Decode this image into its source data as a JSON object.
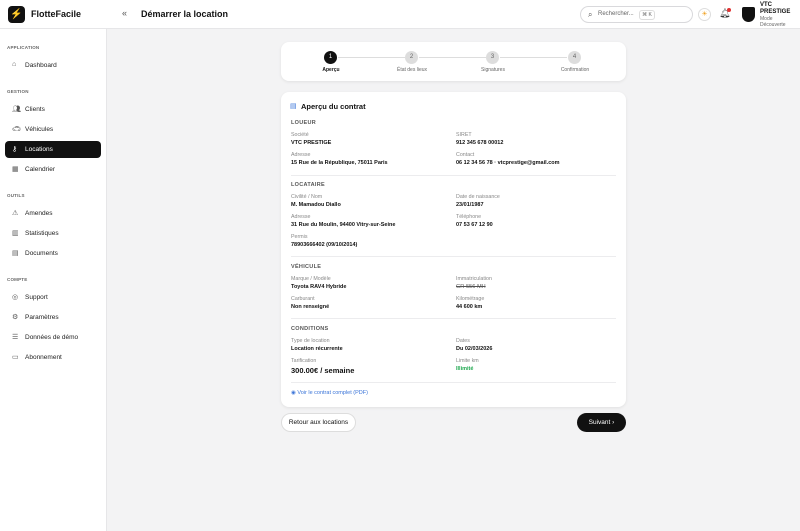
{
  "app": {
    "brand": "FlotteFacile",
    "page_title": "Démarrer la location"
  },
  "header": {
    "search_placeholder": "Rechercher...",
    "search_shortcut": "⌘ K",
    "user_name": "VTC PRESTIGE",
    "user_mode": "Mode Découverte"
  },
  "sidebar": {
    "sections": [
      {
        "title": "APPLICATION",
        "items": [
          {
            "label": "Dashboard",
            "icon": "home-icon"
          }
        ]
      },
      {
        "title": "GESTION",
        "items": [
          {
            "label": "Clients",
            "icon": "users-icon"
          },
          {
            "label": "Véhicules",
            "icon": "car-icon"
          },
          {
            "label": "Locations",
            "icon": "key-icon"
          },
          {
            "label": "Calendrier",
            "icon": "calendar-icon"
          }
        ]
      },
      {
        "title": "OUTILS",
        "items": [
          {
            "label": "Amendes",
            "icon": "alert-icon"
          },
          {
            "label": "Statistiques",
            "icon": "chart-icon"
          },
          {
            "label": "Documents",
            "icon": "document-icon"
          }
        ]
      },
      {
        "title": "COMPTE",
        "items": [
          {
            "label": "Support",
            "icon": "support-icon"
          },
          {
            "label": "Paramètres",
            "icon": "gear-icon"
          },
          {
            "label": "Données de démo",
            "icon": "database-icon"
          },
          {
            "label": "Abonnement",
            "icon": "card-icon"
          }
        ]
      }
    ]
  },
  "stepper": [
    {
      "num": "1",
      "label": "Aperçu"
    },
    {
      "num": "2",
      "label": "État des lieux"
    },
    {
      "num": "3",
      "label": "Signatures"
    },
    {
      "num": "4",
      "label": "Confirmation"
    }
  ],
  "contract": {
    "title": "Aperçu du contrat",
    "loueur": {
      "heading": "LOUEUR",
      "societe_label": "Société",
      "societe": "VTC PRESTIGE",
      "siret_label": "SIRET",
      "siret": "912 345 678 00012",
      "adresse_label": "Adresse",
      "adresse": "15 Rue de la République, 75011 Paris",
      "contact_label": "Contact",
      "contact": "06 12 34 56 78 · vtcprestige@gmail.com"
    },
    "locataire": {
      "heading": "LOCATAIRE",
      "nom_label": "Civilité / Nom",
      "nom": "M. Mamadou Diallo",
      "naissance_label": "Date de naissance",
      "naissance": "23/01/1987",
      "adresse_label": "Adresse",
      "adresse": "31 Rue du Moulin, 94400 Vitry-sur-Seine",
      "tel_label": "Téléphone",
      "tel": "07 53 67 12 90",
      "permis_label": "Permis",
      "permis": "78903666402 (09/10/2014)"
    },
    "vehicule": {
      "heading": "VÉHICULE",
      "modele_label": "Marque / Modèle",
      "modele": "Toyota RAV4 Hybride",
      "immat_label": "Immatriculation",
      "immat": "GR-556-MH",
      "carburant_label": "Carburant",
      "carburant": "Non renseigné",
      "km_label": "Kilométrage",
      "km": "44 600 km"
    },
    "conditions": {
      "heading": "CONDITIONS",
      "type_label": "Type de location",
      "type": "Location récurrente",
      "dates_label": "Dates",
      "dates": "Du 02/03/2026",
      "tarif_label": "Tarification",
      "tarif": "300.00€ / semaine",
      "limite_label": "Limite km",
      "limite": "Illimité"
    },
    "pdf_link": "Voir le contrat complet (PDF)"
  },
  "actions": {
    "back": "Retour aux locations",
    "next": "Suivant"
  }
}
